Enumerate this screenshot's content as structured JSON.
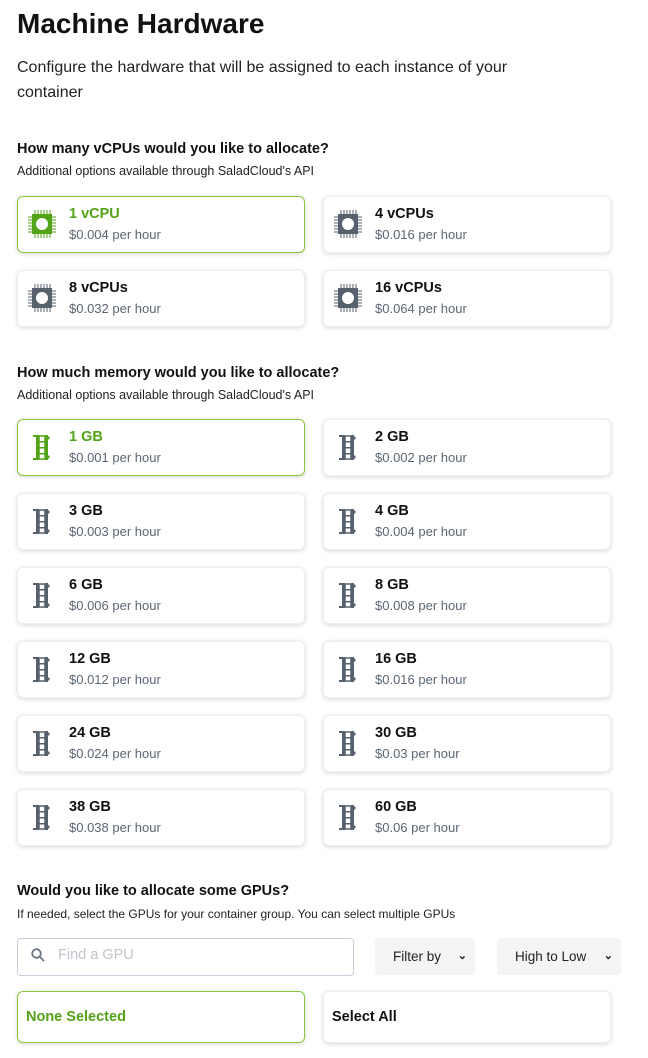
{
  "title": "Machine Hardware",
  "subtitle": "Configure the hardware that will be assigned to each instance of your container",
  "accent": "#53a318",
  "cpu": {
    "heading": "How many vCPUs would you like to allocate?",
    "note": "Additional options available through SaladCloud's API",
    "icon": "cpu-chip-icon",
    "options": [
      {
        "label": "1 vCPU",
        "price": "$0.004 per hour",
        "selected": true
      },
      {
        "label": "4 vCPUs",
        "price": "$0.016 per hour",
        "selected": false
      },
      {
        "label": "8 vCPUs",
        "price": "$0.032 per hour",
        "selected": false
      },
      {
        "label": "16 vCPUs",
        "price": "$0.064 per hour",
        "selected": false
      }
    ]
  },
  "memory": {
    "heading": "How much memory would you like to allocate?",
    "note": "Additional options available through SaladCloud's API",
    "icon": "memory-stick-icon",
    "options": [
      {
        "label": "1 GB",
        "price": "$0.001 per hour",
        "selected": true
      },
      {
        "label": "2 GB",
        "price": "$0.002 per hour",
        "selected": false
      },
      {
        "label": "3 GB",
        "price": "$0.003 per hour",
        "selected": false
      },
      {
        "label": "4 GB",
        "price": "$0.004 per hour",
        "selected": false
      },
      {
        "label": "6 GB",
        "price": "$0.006 per hour",
        "selected": false
      },
      {
        "label": "8 GB",
        "price": "$0.008 per hour",
        "selected": false
      },
      {
        "label": "12 GB",
        "price": "$0.012 per hour",
        "selected": false
      },
      {
        "label": "16 GB",
        "price": "$0.016 per hour",
        "selected": false
      },
      {
        "label": "24 GB",
        "price": "$0.024 per hour",
        "selected": false
      },
      {
        "label": "30 GB",
        "price": "$0.03 per hour",
        "selected": false
      },
      {
        "label": "38 GB",
        "price": "$0.038 per hour",
        "selected": false
      },
      {
        "label": "60 GB",
        "price": "$0.06 per hour",
        "selected": false
      }
    ]
  },
  "gpu": {
    "heading": "Would you like to allocate some GPUs?",
    "note": "If needed, select the GPUs for your container group. You can select multiple GPUs",
    "search_placeholder": "Find a GPU",
    "filter_label": "Filter by",
    "sort_label": "High to Low",
    "none_label": "None Selected",
    "all_label": "Select All"
  }
}
